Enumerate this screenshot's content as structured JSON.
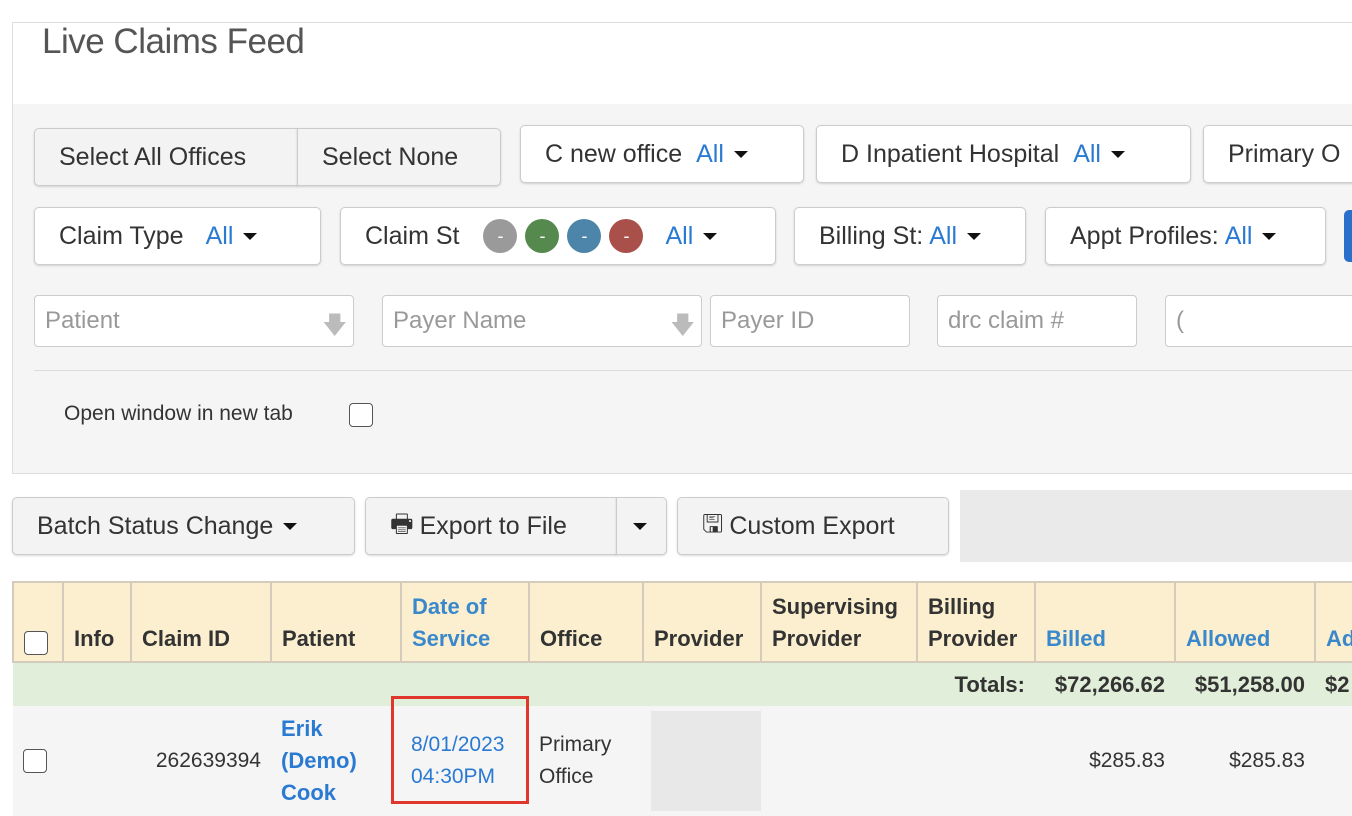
{
  "title": "Live Claims Feed",
  "filters": {
    "select_all": "Select All Offices",
    "select_none": "Select None",
    "office1": {
      "label": "C new office",
      "value": "All"
    },
    "office2": {
      "label": "D Inpatient Hospital",
      "value": "All"
    },
    "office3": {
      "label": "Primary O"
    },
    "claim_type": {
      "label": "Claim Type",
      "value": "All"
    },
    "claim_status": {
      "label": "Claim St",
      "value": "All",
      "dots": [
        {
          "color": "#9a9a9a",
          "text": "-"
        },
        {
          "color": "#55894d",
          "text": "-"
        },
        {
          "color": "#4d84aa",
          "text": "-"
        },
        {
          "color": "#a9504b",
          "text": "-"
        }
      ]
    },
    "billing_status": {
      "label": "Billing St:",
      "value": "All"
    },
    "appt_profiles": {
      "label": "Appt Profiles:",
      "value": "All"
    },
    "patient_placeholder": "Patient",
    "payer_name_placeholder": "Payer Name",
    "payer_id_placeholder": "Payer ID",
    "drc_claim_placeholder": "drc claim #",
    "extra_input_value": "(",
    "open_new_tab": "Open window in new tab"
  },
  "toolbar": {
    "batch": "Batch Status Change",
    "export": "Export to File",
    "custom_export": "Custom Export"
  },
  "table": {
    "headers": [
      "Info",
      "Claim ID",
      "Patient",
      "Date of Service",
      "Office",
      "Provider",
      "Supervising Provider",
      "Billing Provider",
      "Billed",
      "Allowed",
      "Ad"
    ],
    "totals": {
      "label": "Totals:",
      "billed": "$72,266.62",
      "allowed": "$51,258.00",
      "adj": "$2"
    },
    "rows": [
      {
        "claim_id": "262639394",
        "patient": "Erik (Demo) Cook",
        "date": "8/01/2023",
        "time": "04:30PM",
        "office": "Primary Office",
        "billed": "$285.83",
        "allowed": "$285.83"
      }
    ]
  },
  "colors": {
    "accent": "#2a7ad2",
    "highlight": "#e0362c",
    "header_bg": "#fcefcf",
    "totals_bg": "#e1eed9"
  }
}
